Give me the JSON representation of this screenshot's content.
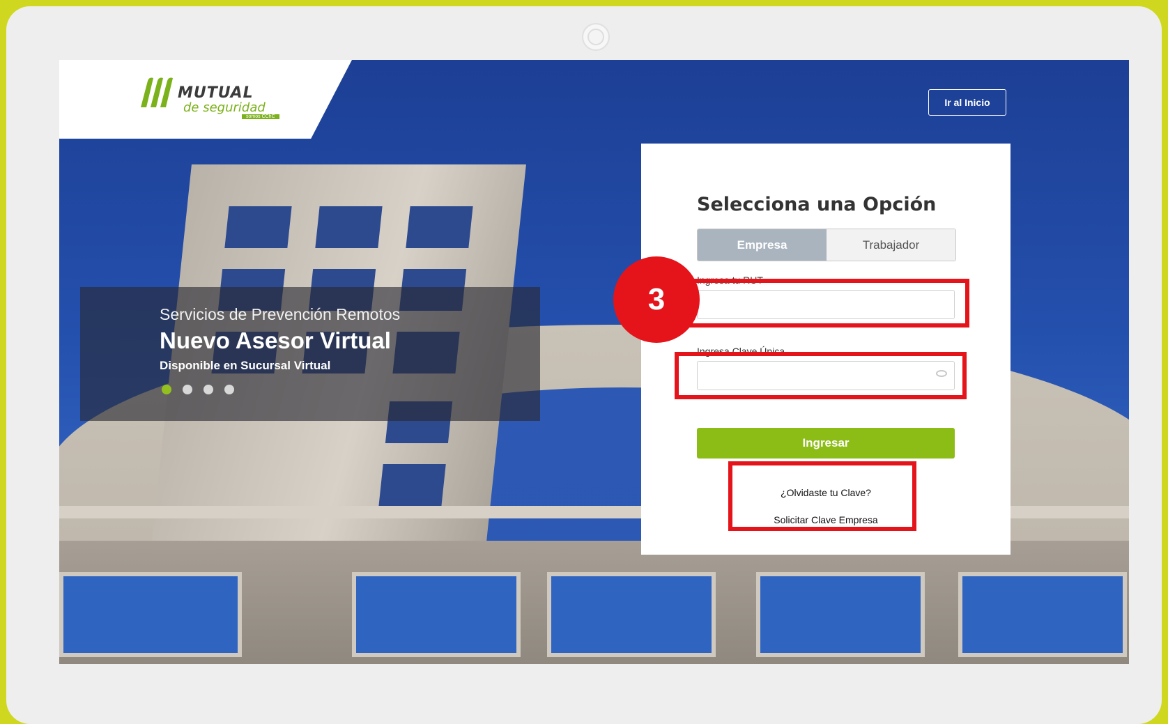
{
  "header": {
    "logo_name": "MUTUAL",
    "logo_tagline": "de seguridad",
    "logo_sub": "somos CChC",
    "home_button": "Ir al Inicio"
  },
  "banner": {
    "line1": "Servicios de Prevención Remotos",
    "line2": "Nuevo Asesor Virtual",
    "line3": "Disponible en Sucursal Virtual",
    "active_slide": 1,
    "slide_count": 4
  },
  "login": {
    "title": "Selecciona una Opción",
    "tabs": [
      "Empresa",
      "Trabajador"
    ],
    "selected_tab": "Empresa",
    "rut_label": "Ingresa tu RUT",
    "rut_value": "",
    "clave_label": "Ingresa Clave Única",
    "clave_value": "",
    "submit": "Ingresar",
    "forgot_link": "¿Olvidaste tu Clave?",
    "request_link": "Solicitar Clave Empresa"
  },
  "annotation": {
    "step": "3",
    "color": "#e4141a"
  },
  "colors": {
    "accent_green": "#8cbc16",
    "frame": "#cfd81f"
  },
  "icons": {
    "password_toggle": "eye-icon",
    "logo": "mutual-logo-icon"
  }
}
